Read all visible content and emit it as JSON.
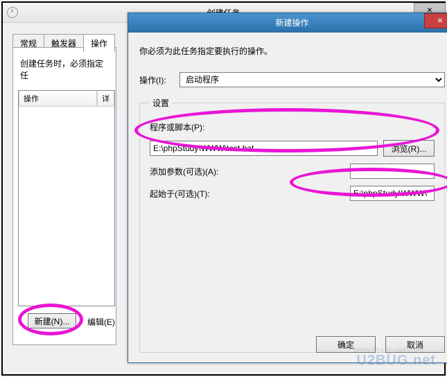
{
  "parentWindow": {
    "title": "创建任务",
    "closeGlyph": "×",
    "tabs": {
      "general": "常规",
      "triggers": "触发器",
      "actions": "操作"
    },
    "note": "创建任务时，必须指定任",
    "table": {
      "col1": "操作",
      "col2": "详"
    },
    "newBtn": "新建(N)...",
    "editTxt": "编辑(E)"
  },
  "dialog": {
    "title": "新建操作",
    "closeGlyph": "×",
    "instruction": "你必须为此任务指定要执行的操作。",
    "actionLabel": "操作(I):",
    "actionOption": "启动程序",
    "settingsLegend": "设置",
    "programLabel": "程序或脚本(P):",
    "programValue": "E:\\phpStudy\\WWW\\test.bat",
    "browseBtn": "浏览(R)...",
    "argsLabel": "添加参数(可选)(A):",
    "argsValue": "",
    "startInLabel": "起始于(可选)(T):",
    "startInValue": "E:\\phpStudy\\WWW\\",
    "okBtn": "确定",
    "cancelBtn": "取消"
  },
  "watermark": {
    "blog": "https://blog.csdn.net/...",
    "brand": "U2BUG.net"
  }
}
